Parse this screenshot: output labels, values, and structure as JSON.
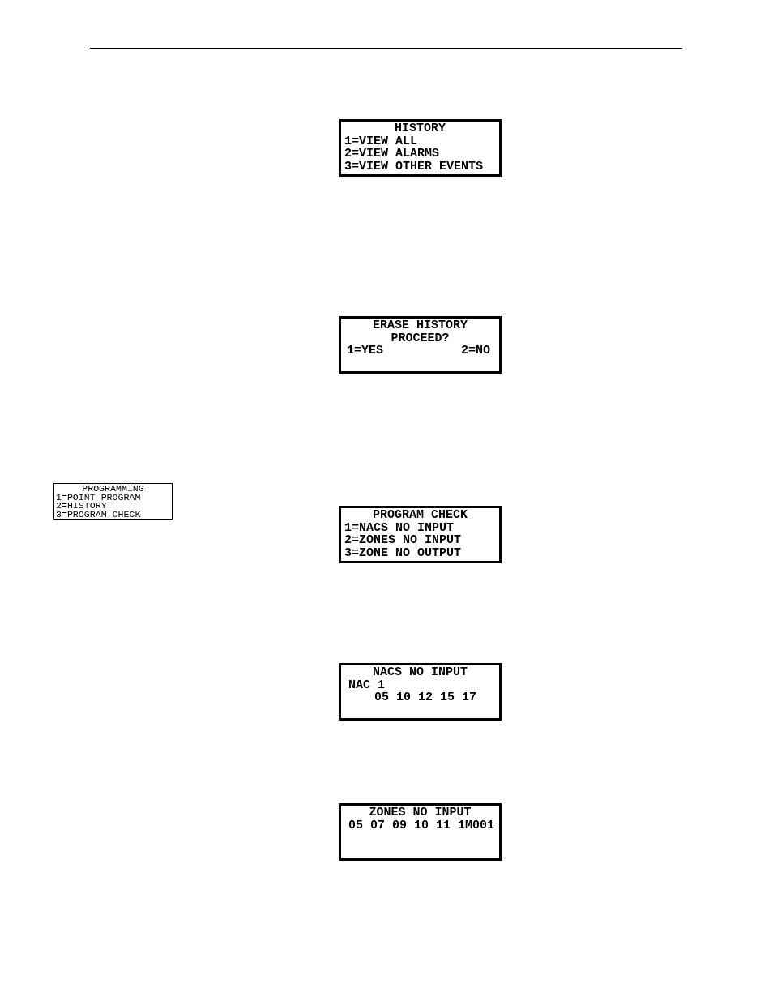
{
  "displays": [
    {
      "kind": "main",
      "lines": [
        {
          "kind": "heading",
          "text": "HISTORY"
        },
        {
          "kind": "option",
          "text": "1=VIEW ALL"
        },
        {
          "kind": "option",
          "text": "2=VIEW ALARMS"
        },
        {
          "kind": "option",
          "text": "3=VIEW OTHER EVENTS"
        }
      ]
    },
    {
      "kind": "main",
      "lines": [
        {
          "kind": "heading",
          "text": "ERASE HISTORY"
        },
        {
          "kind": "heading",
          "text": "PROCEED?"
        },
        {
          "kind": "split",
          "left": "1=YES",
          "right": "2=NO"
        }
      ]
    },
    {
      "kind": "compact",
      "lines": [
        {
          "kind": "heading",
          "text": "PROGRAMMING"
        },
        {
          "kind": "option",
          "text": "1=POINT PROGRAM"
        },
        {
          "kind": "option",
          "text": "2=HISTORY"
        },
        {
          "kind": "option",
          "text": "3=PROGRAM CHECK"
        }
      ]
    },
    {
      "kind": "main",
      "lines": [
        {
          "kind": "heading",
          "text": "PROGRAM CHECK"
        },
        {
          "kind": "option",
          "text": "1=NACS NO INPUT"
        },
        {
          "kind": "option",
          "text": "2=ZONES NO INPUT"
        },
        {
          "kind": "option",
          "text": "3=ZONE NO OUTPUT"
        }
      ]
    },
    {
      "kind": "main",
      "lines": [
        {
          "kind": "heading",
          "text": "NACS NO INPUT"
        },
        {
          "kind": "inset",
          "text": "NAC 1"
        },
        {
          "kind": "indented",
          "text": "05 10 12 15 17"
        }
      ]
    },
    {
      "kind": "main",
      "lines": [
        {
          "kind": "heading",
          "text": "ZONES NO INPUT"
        },
        {
          "kind": "inset",
          "text": "05 07 09 10 11 1M001"
        }
      ]
    }
  ]
}
